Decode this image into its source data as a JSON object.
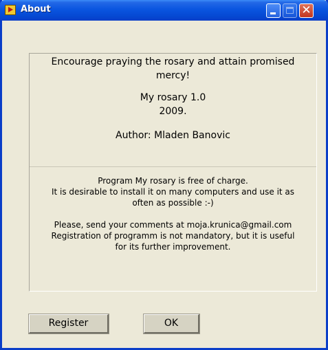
{
  "window": {
    "title": "About",
    "controls": {
      "minimize": "minimize",
      "maximize": "maximize",
      "close": "close"
    }
  },
  "about": {
    "slogan_line1": "Encourage praying the rosary and attain promised",
    "slogan_line2": "mercy!",
    "app_name": "My rosary 1.0",
    "year": "2009.",
    "author": "Author: Mladen Banovic"
  },
  "info": {
    "line1": "Program My rosary is free of charge.",
    "line2": "It is desirable to install it on many computers and use it as",
    "line3": "often as possible :-)",
    "line4": "Please, send your comments at moja.krunica@gmail.com",
    "line5": "Registration of programm is not mandatory, but it is useful",
    "line6": "for its further improvement."
  },
  "buttons": {
    "register": "Register",
    "ok": "OK"
  },
  "colors": {
    "titlebar": "#0A55E0",
    "window_bg": "#ECE9D8",
    "close_button": "#C2351E"
  },
  "icons": {
    "app": "app-icon",
    "minimize": "minimize-icon",
    "maximize": "maximize-icon",
    "close": "close-icon"
  }
}
